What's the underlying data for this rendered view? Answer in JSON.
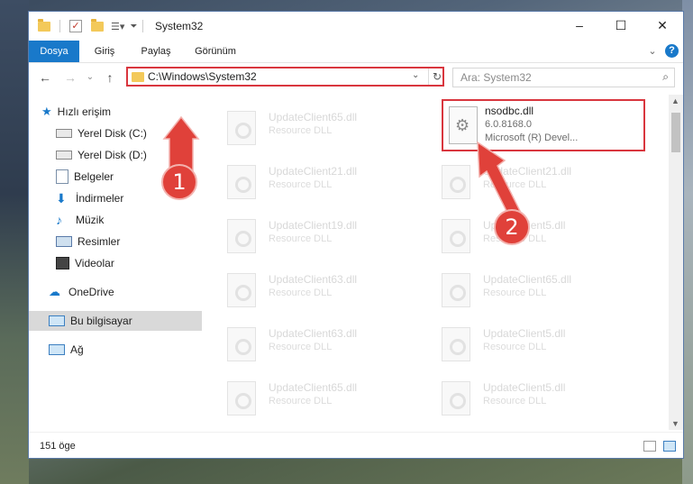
{
  "window": {
    "title": "System32",
    "minimize": "–",
    "maximize": "☐",
    "close": "✕"
  },
  "ribbon": {
    "tabs": [
      "Dosya",
      "Giriş",
      "Paylaş",
      "Görünüm"
    ],
    "active_tab": "Dosya",
    "expand": "⌄",
    "help": "?"
  },
  "nav": {
    "back": "←",
    "forward": "→",
    "recent": "⌄",
    "up": "↑"
  },
  "address": {
    "path": "C:\\Windows\\System32",
    "dropdown": "⌄",
    "refresh": "↻"
  },
  "search": {
    "placeholder": "Ara: System32",
    "icon": "⌕"
  },
  "sidebar": {
    "quick_access": "Hızlı erişim",
    "items": [
      {
        "label": "Yerel Disk (C:)",
        "icon": "drive-icon",
        "pin": "📌"
      },
      {
        "label": "Yerel Disk (D:)",
        "icon": "drive-icon",
        "pin": "📌"
      },
      {
        "label": "Belgeler",
        "icon": "documents-icon",
        "pin": "📌"
      },
      {
        "label": "İndirmeler",
        "icon": "download-icon",
        "pin": "📌"
      },
      {
        "label": "Müzik",
        "icon": "music-icon",
        "pin": "📌"
      },
      {
        "label": "Resimler",
        "icon": "pictures-icon",
        "pin": "📌"
      },
      {
        "label": "Videolar",
        "icon": "video-icon",
        "pin": "📌"
      }
    ],
    "onedrive": "OneDrive",
    "this_pc": "Bu bilgisayar",
    "network": "Ağ"
  },
  "files": {
    "left_column": [
      {
        "name": "UpdateClient65.dll",
        "type": "Resource DLL"
      },
      {
        "name": "UpdateClient21.dll",
        "type": "Resource DLL"
      },
      {
        "name": "UpdateClient19.dll",
        "type": "Resource DLL"
      },
      {
        "name": "UpdateClient63.dll",
        "type": "Resource DLL"
      },
      {
        "name": "UpdateClient63.dll",
        "type": "Resource DLL"
      },
      {
        "name": "UpdateClient65.dll",
        "type": "Resource DLL"
      }
    ],
    "right_column": [
      {
        "name": "UpdateClient21.dll",
        "type": "Resource DLL"
      },
      {
        "name": "UpdateClient5.dll",
        "type": "Resource DLL"
      },
      {
        "name": "UpdateClient65.dll",
        "type": "Resource DLL"
      },
      {
        "name": "UpdateClient5.dll",
        "type": "Resource DLL"
      },
      {
        "name": "UpdateClient5.dll",
        "type": "Resource DLL"
      }
    ],
    "highlighted": {
      "name": "nsodbc.dll",
      "version": "6.0.8168.0",
      "description": "Microsoft (R) Devel..."
    }
  },
  "status": {
    "count": "151 öge"
  },
  "annotations": {
    "step1": "1",
    "step2": "2",
    "color": "#e0413a"
  }
}
